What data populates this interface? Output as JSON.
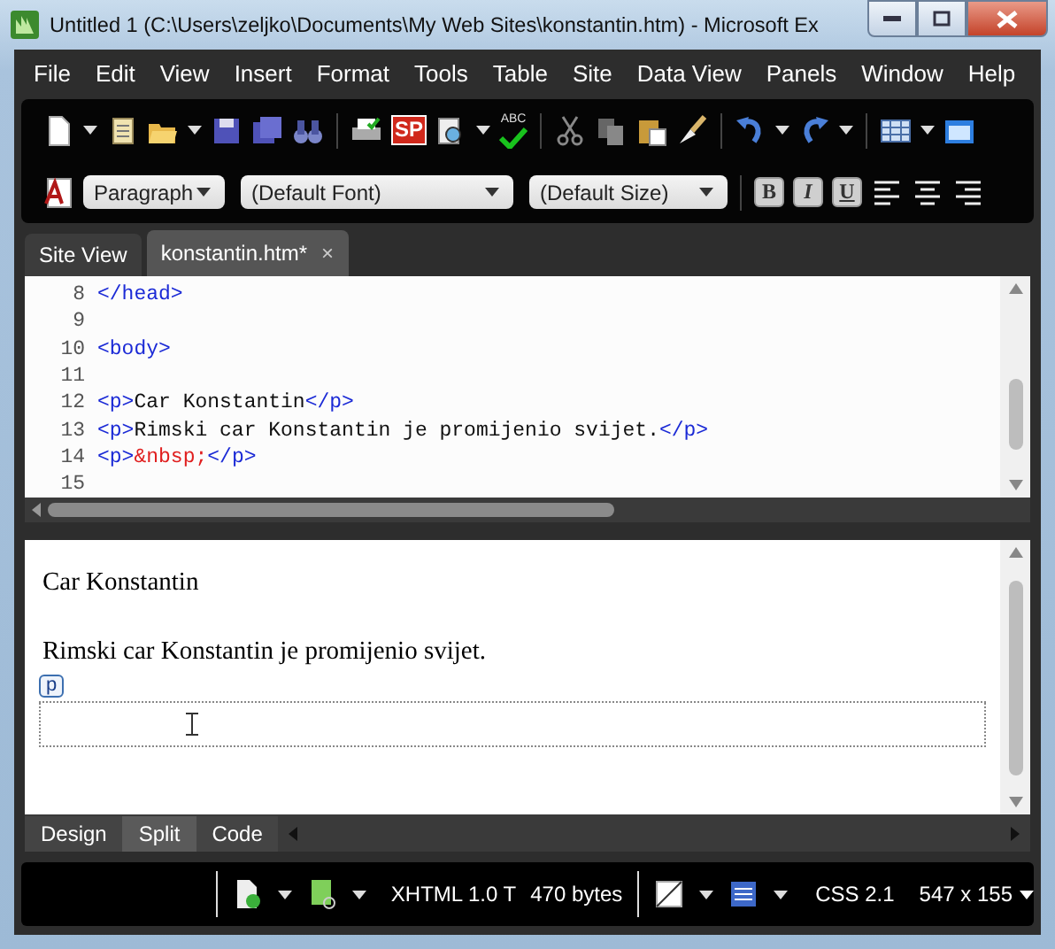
{
  "window": {
    "title": "Untitled 1 (C:\\Users\\zeljko\\Documents\\My Web Sites\\konstantin.htm) - Microsoft Ex"
  },
  "menu": [
    "File",
    "Edit",
    "View",
    "Insert",
    "Format",
    "Tools",
    "Table",
    "Site",
    "Data View",
    "Panels",
    "Window",
    "Help"
  ],
  "toolbar": {
    "sp_label": "SP",
    "spell_label": "ABC",
    "style_dropdown": "Paragraph",
    "font_dropdown": "(Default Font)",
    "size_dropdown": "(Default Size)",
    "bold": "B",
    "italic": "I",
    "underline": "U"
  },
  "tabs": [
    {
      "label": "Site View",
      "selected": false,
      "closable": false
    },
    {
      "label": "konstantin.htm*",
      "selected": true,
      "closable": true
    }
  ],
  "close_glyph": "×",
  "code_lines": [
    {
      "number": "8",
      "tokens": [
        {
          "kind": "tag",
          "text": "</head>"
        }
      ]
    },
    {
      "number": "9"
    },
    {
      "number": "10",
      "tokens": [
        {
          "kind": "tag",
          "text": "<body>"
        }
      ]
    },
    {
      "number": "11"
    },
    {
      "number": "12",
      "tokens": [
        {
          "kind": "tag",
          "text": "<p>"
        },
        {
          "kind": "text",
          "text": "Car Konstantin"
        },
        {
          "kind": "tag",
          "text": "</p>"
        }
      ]
    },
    {
      "number": "13",
      "tokens": [
        {
          "kind": "tag",
          "text": "<p>"
        },
        {
          "kind": "text",
          "text": "Rimski car Konstantin je promijenio svijet."
        },
        {
          "kind": "tag",
          "text": "</p>"
        }
      ]
    },
    {
      "number": "14",
      "tokens": [
        {
          "kind": "tag",
          "text": "<p>"
        },
        {
          "kind": "entity",
          "text": "&nbsp;"
        },
        {
          "kind": "tag",
          "text": "</p>"
        }
      ]
    },
    {
      "number": "15"
    }
  ],
  "design": {
    "paragraphs": [
      "Car Konstantin",
      "Rimski car Konstantin je promijenio svijet."
    ],
    "tag_label": "p"
  },
  "view_tabs": [
    {
      "label": "Design",
      "selected": false
    },
    {
      "label": "Split",
      "selected": true
    },
    {
      "label": "Code",
      "selected": false
    }
  ],
  "status_bar": {
    "doctype": "XHTML 1.0 T",
    "size": "470 bytes",
    "css": "CSS 2.1",
    "dimensions": "547 x 155"
  }
}
